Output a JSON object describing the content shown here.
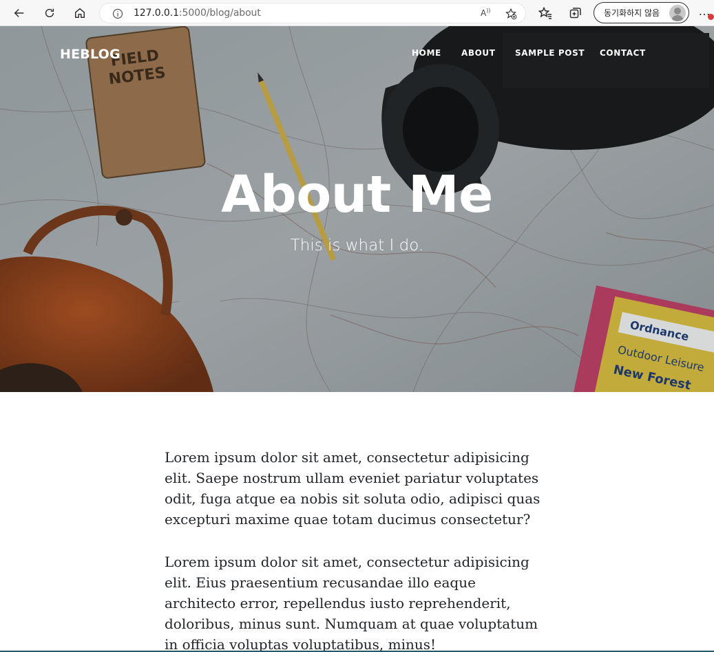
{
  "browser": {
    "url_host": "127.0.0.1",
    "url_rest": ":5000/blog/about",
    "read_aloud_icon": "A¹⁾",
    "sync_label": "동기화하지 않음",
    "more_label": "…"
  },
  "site": {
    "brand": "HEBLOG",
    "nav": [
      "HOME",
      "ABOUT",
      "SAMPLE POST",
      "CONTACT"
    ]
  },
  "hero": {
    "title": "About Me",
    "subtitle": "This is what I do."
  },
  "content": {
    "paragraphs": [
      "Lorem ipsum dolor sit amet, consectetur adipisicing elit. Saepe nostrum ullam eveniet pariatur voluptates odit, fuga atque ea nobis sit soluta odio, adipisci quas excepturi maxime quae totam ducimus consectetur?",
      "Lorem ipsum dolor sit amet, consectetur adipisicing elit. Eius praesentium recusandae illo eaque architecto error, repellendus iusto reprehenderit, doloribus, minus sunt. Numquam at quae voluptatum in officia voluptas voluptatibus, minus!"
    ]
  },
  "icons": {
    "back": "arrow-left-icon",
    "reload": "refresh-icon",
    "home": "home-icon",
    "info": "info-icon",
    "favorites_add": "star-plus-icon",
    "favorites": "star-list-icon",
    "collections": "collections-icon"
  },
  "colors": {
    "nav_text": "#ffffff",
    "body_text": "#212529"
  }
}
